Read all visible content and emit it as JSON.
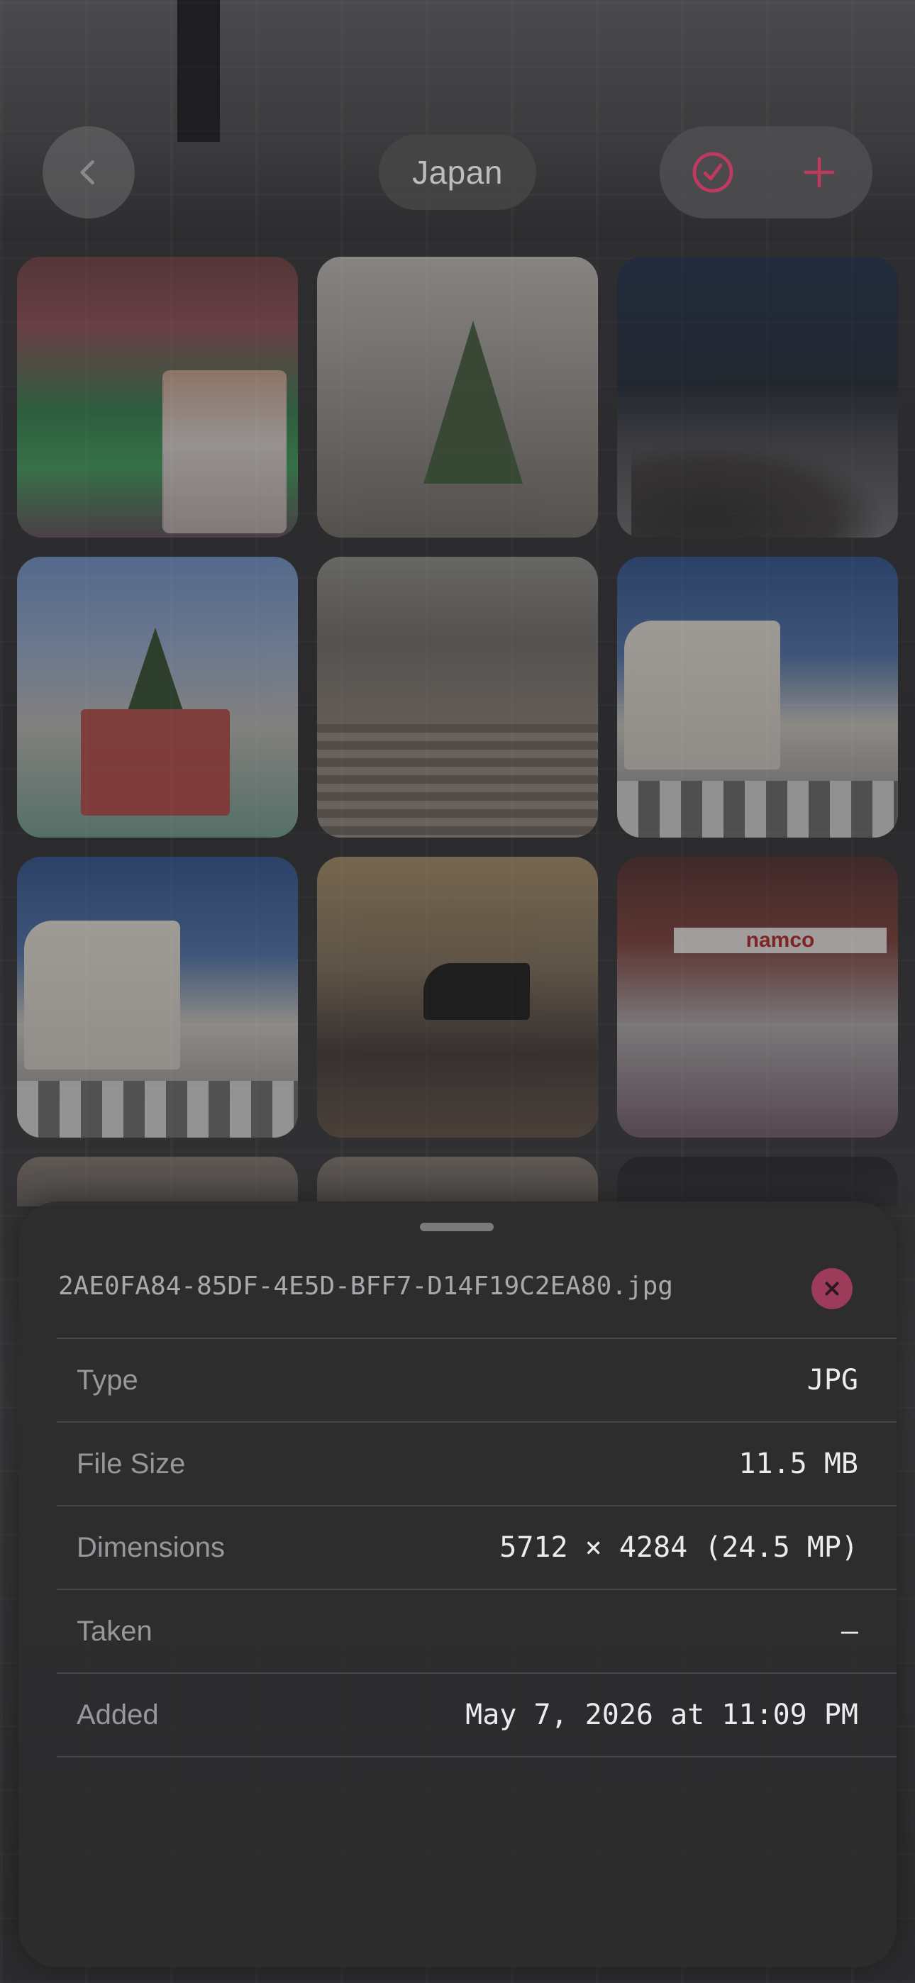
{
  "nav": {
    "title": "Japan"
  },
  "photos": [
    {
      "name": "photo-figure-display"
    },
    {
      "name": "photo-christmas-tree-mall"
    },
    {
      "name": "photo-night-crowd"
    },
    {
      "name": "photo-christmas-booth"
    },
    {
      "name": "photo-staircase-atrium"
    },
    {
      "name": "photo-curved-building"
    },
    {
      "name": "photo-curved-building-2"
    },
    {
      "name": "photo-piano-concert"
    },
    {
      "name": "photo-namco-store",
      "sign_text": "namco"
    }
  ],
  "info": {
    "filename": "2AE0FA84-85DF-4E5D-BFF7-D14F19C2EA80.jpg",
    "rows": [
      {
        "label": "Type",
        "value": "JPG"
      },
      {
        "label": "File Size",
        "value": "11.5 MB"
      },
      {
        "label": "Dimensions",
        "value": "5712 × 4284 (24.5 MP)"
      },
      {
        "label": "Taken",
        "value": "—"
      },
      {
        "label": "Added",
        "value": "May 7, 2026 at 11:09 PM"
      }
    ]
  },
  "colors": {
    "accent": "#9c3b5a",
    "accent_icon": "#c0395f"
  },
  "icons": {
    "back": "chevron-left-icon",
    "select": "checkmark-circle-icon",
    "add": "plus-icon",
    "close": "xmark-icon"
  }
}
